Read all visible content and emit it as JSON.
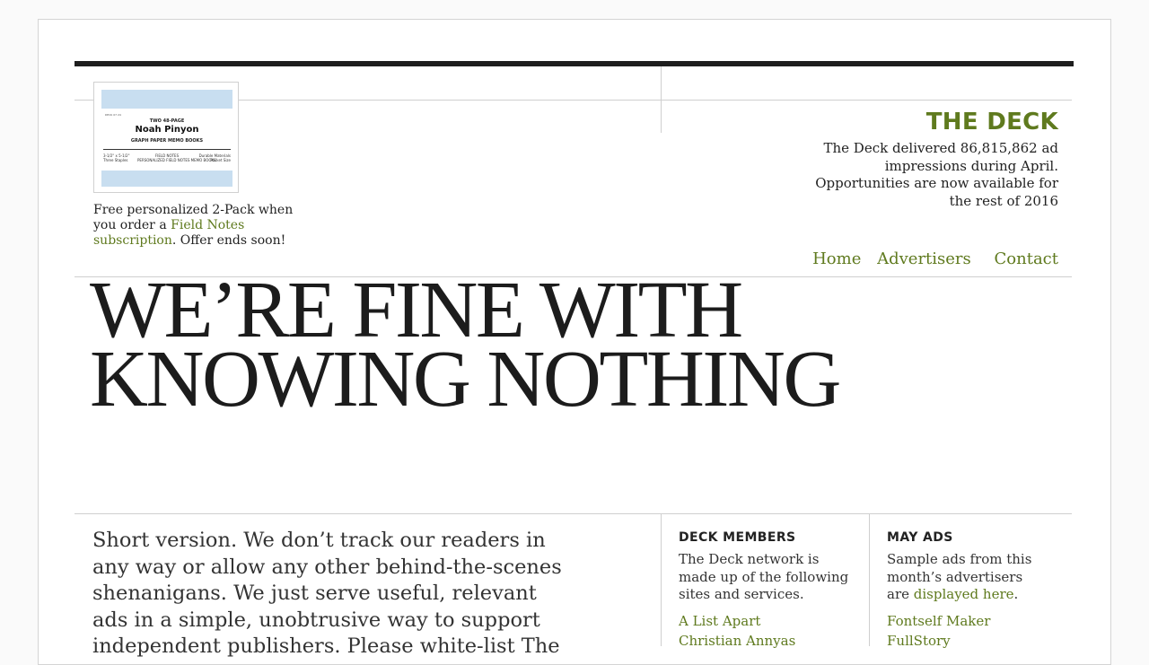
{
  "ad": {
    "image": {
      "tiny_label": "DECK 07 24",
      "line1": "TWO 48-PAGE",
      "name": "Noah Pinyon",
      "line3": "GRAPH PAPER MEMO BOOKS",
      "foot_left": "3-1/2\" x 5-1/2\"\nThree Staples",
      "foot_center": "FIELD NOTES\nPERSONALIZED FIELD NOTES MEMO BOOKS",
      "foot_right": "Durable Materials\nPocket Size"
    },
    "text_pre": "Free personalized 2-Pack when you order a ",
    "link": "Field Notes subscription",
    "text_post": ". Offer ends soon!"
  },
  "deck": {
    "title": "THE DECK",
    "description": "The Deck delivered 86,815,862 ad impressions during April. Opportunities are now available for the rest of 2016"
  },
  "nav": [
    "Home",
    "Advertisers",
    "Contact"
  ],
  "headline": {
    "line1": "WE’RE FINE WITH",
    "line2": "KNOWING NOTHING"
  },
  "body": "Short version. We don’t track our readers in any way or allow any other behind-the-scenes shenanigans. We just serve useful, relevant ads in a simple, unobtrusive way to support independent publishers. Please white-list The",
  "members": {
    "title": "DECK MEMBERS",
    "text": "The Deck network is made up of the following sites and services.",
    "links": [
      "A List Apart",
      "Christian Annyas"
    ]
  },
  "may_ads": {
    "title": "MAY ADS",
    "text_pre": "Sample ads from this month’s advertisers are ",
    "link": "displayed here",
    "text_post": ".",
    "links": [
      "Fontself Maker",
      "FullStory"
    ]
  }
}
